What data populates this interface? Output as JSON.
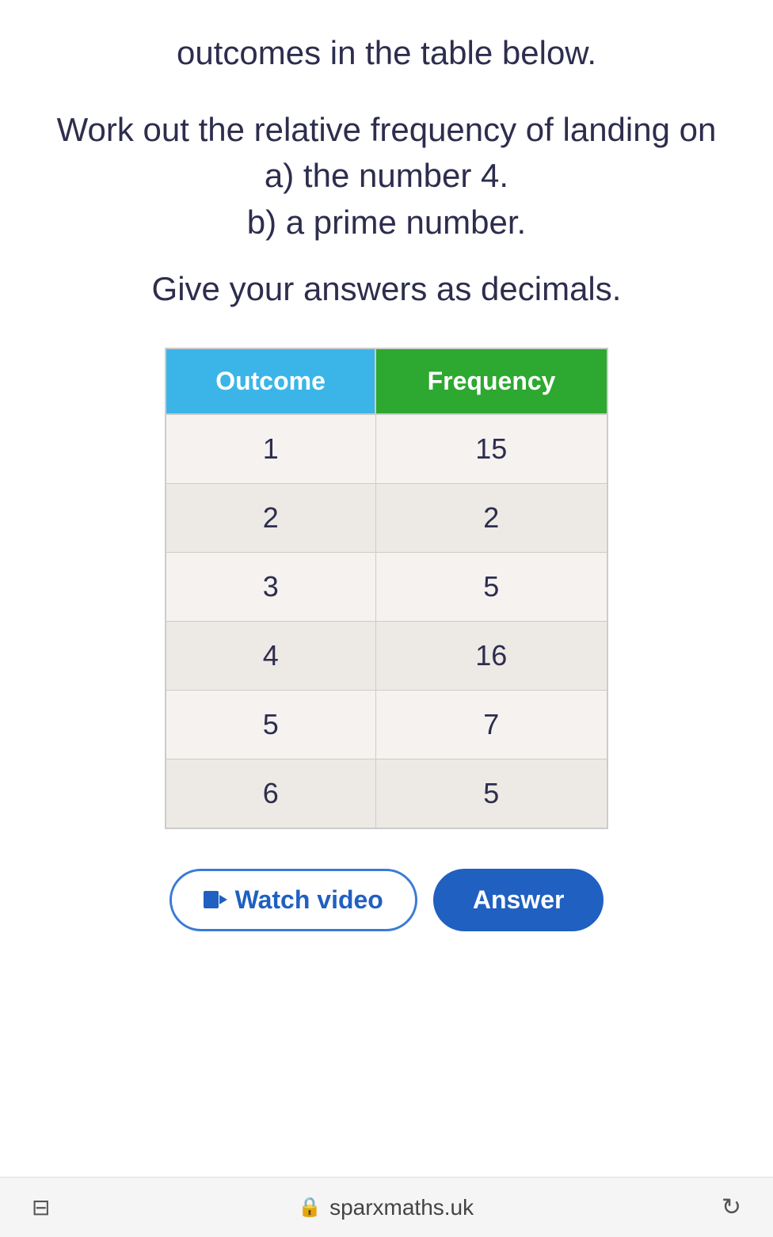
{
  "page": {
    "subtitle": "outcomes in the table below.",
    "question": "Work out the relative frequency of landing on\na) the number 4.\nb) a prime number.",
    "give_answers": "Give your answers as decimals.",
    "table": {
      "headers": {
        "outcome": "Outcome",
        "frequency": "Frequency"
      },
      "rows": [
        {
          "outcome": "1",
          "frequency": "15"
        },
        {
          "outcome": "2",
          "frequency": "2"
        },
        {
          "outcome": "3",
          "frequency": "5"
        },
        {
          "outcome": "4",
          "frequency": "16"
        },
        {
          "outcome": "5",
          "frequency": "7"
        },
        {
          "outcome": "6",
          "frequency": "5"
        }
      ]
    },
    "watch_video_label": "Watch video",
    "answer_label": "Answer",
    "bottom_bar": {
      "url": "sparxmaths.uk"
    }
  }
}
